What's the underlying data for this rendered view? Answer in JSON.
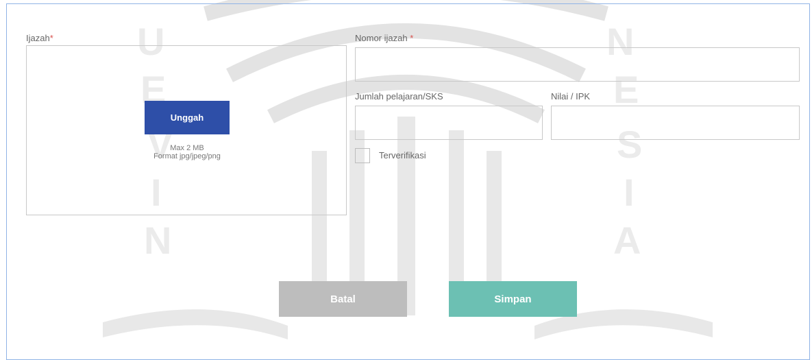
{
  "form": {
    "ijazah": {
      "label": "Ijazah",
      "required_mark": "*"
    },
    "upload": {
      "button_label": "Unggah",
      "max_size": "Max 2 MB",
      "formats": "Format jpg/jpeg/png"
    },
    "nomor_ijazah": {
      "label": "Nomor ijazah ",
      "required_mark": "*",
      "value": ""
    },
    "jumlah": {
      "label": "Jumlah pelajaran/SKS",
      "value": ""
    },
    "nilai": {
      "label": "Nilai / IPK",
      "value": ""
    },
    "verified": {
      "label": "Terverifikasi",
      "checked": false
    }
  },
  "actions": {
    "cancel_label": "Batal",
    "save_label": "Simpan"
  },
  "colors": {
    "primary": "#2e4fa8",
    "save": "#6cc0b3",
    "cancel": "#bdbdbd",
    "required": "#d9534f",
    "panel_border": "#8fb3e6"
  }
}
